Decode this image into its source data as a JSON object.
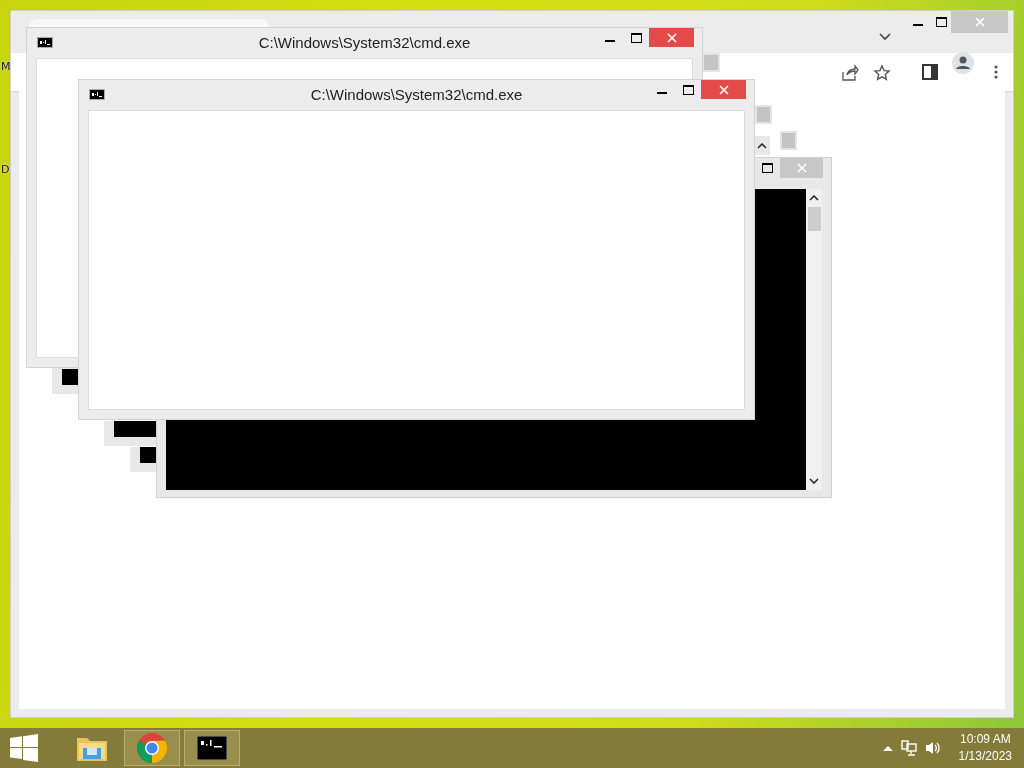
{
  "desktop_labels": [
    "M",
    "D"
  ],
  "cmd_windows": [
    {
      "title": "C:\\Windows\\System32\\cmd.exe"
    },
    {
      "title": "C:\\Windows\\System32\\cmd.exe"
    }
  ],
  "taskbar": {
    "items": [
      {
        "kind": "explorer",
        "running": false
      },
      {
        "kind": "chrome",
        "running": true
      },
      {
        "kind": "cmd",
        "running": true
      }
    ]
  },
  "clock": {
    "time": "10:09 AM",
    "date": "1/13/2023"
  }
}
